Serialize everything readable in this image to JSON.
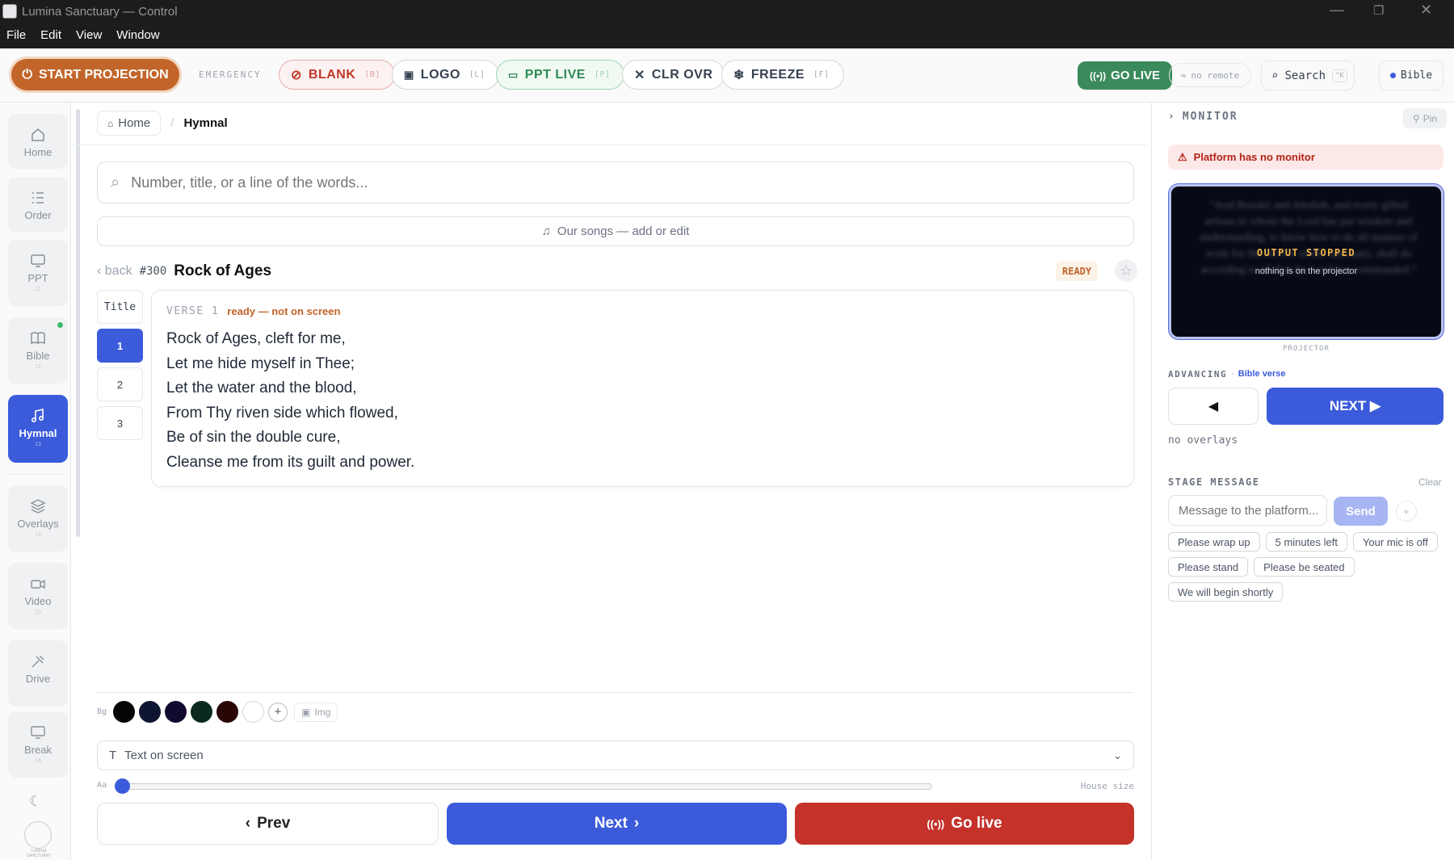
{
  "window": {
    "title": "Lumina Sanctuary — Control",
    "minimize": "—",
    "maximize": "❐",
    "close": "✕"
  },
  "menu": [
    "File",
    "Edit",
    "View",
    "Window"
  ],
  "toolbar": {
    "start_projection": "START PROJECTION",
    "emergency": "EMERGENCY",
    "blank": {
      "label": "BLANK",
      "key": "[B]"
    },
    "logo": {
      "label": "LOGO",
      "key": "[L]"
    },
    "ppt_live": {
      "label": "PPT LIVE",
      "key": "[P]"
    },
    "clr_ovr": {
      "label": "CLR OVR"
    },
    "freeze": {
      "label": "FREEZE",
      "key": "[F]"
    },
    "go_live": "GO LIVE",
    "no_remote": "no remote",
    "search": {
      "label": "Search",
      "key": "^K"
    },
    "bible": "Bible"
  },
  "sidebar": [
    {
      "label": "Home",
      "num": "",
      "icon": "home-icon"
    },
    {
      "label": "Order",
      "num": "",
      "icon": "list-icon"
    },
    {
      "label": "PPT",
      "num": "11",
      "icon": "monitor-icon"
    },
    {
      "label": "Bible",
      "num": "12",
      "icon": "book-icon"
    },
    {
      "label": "Hymnal",
      "num": "13",
      "icon": "music-icon"
    },
    {
      "label": "Overlays",
      "num": "14",
      "icon": "layers-icon"
    },
    {
      "label": "Video",
      "num": "15",
      "icon": "video-icon"
    },
    {
      "label": "Drive",
      "num": "",
      "icon": "drive-icon"
    },
    {
      "label": "Break",
      "num": "16",
      "icon": "screen-icon"
    }
  ],
  "logo_text": "LUMINA SANCTUARY",
  "breadcrumb": {
    "home": "Home",
    "sep": "/",
    "current": "Hymnal"
  },
  "search": {
    "placeholder": "Number, title, or a line of the words..."
  },
  "our_songs": "Our songs — add or edit",
  "song": {
    "back": "back",
    "number": "#300",
    "title": "Rock of Ages",
    "status": "READY"
  },
  "verse_nav": [
    "Title",
    "1",
    "2",
    "3"
  ],
  "verse": {
    "label": "VERSE 1",
    "status": "ready — not on screen",
    "lines": [
      "Rock of Ages, cleft for me,",
      "Let me hide myself in Thee;",
      "Let the water and the blood,",
      "From Thy riven side which flowed,",
      "Be of sin the double cure,",
      "Cleanse me from its guilt and power."
    ]
  },
  "bg": {
    "label": "Bg",
    "colors": [
      "#050505",
      "#0d1530",
      "#120a2e",
      "#0a2a1e",
      "#2a0505",
      "#ffffff"
    ],
    "add": "+",
    "img": "Img"
  },
  "text_on_screen": "Text on screen",
  "size": {
    "label": "Aa",
    "value_label": "House size",
    "value": 0.0
  },
  "bottom": {
    "prev": "Prev",
    "next": "Next",
    "golive": "Go live"
  },
  "monitor": {
    "heading": "MONITOR",
    "pin": "Pin",
    "warning": "Platform has no monitor",
    "preview_text": "“And Bezalel and Aholiab, and every gifted artisan in whom the Lord has put wisdom and understanding, to know how to do all manner of work for the service of the sanctuary, shall do according to all that the Lord has commanded.”",
    "output_stopped": "OUTPUT STOPPED",
    "output_sub": "nothing is on the projector",
    "projector_label": "PROJECTOR"
  },
  "advancing": {
    "label": "ADVANCING",
    "dot": "·",
    "mode": "Bible verse",
    "prev": "◀",
    "next": "NEXT ▶",
    "overlays": "no overlays"
  },
  "stage_message": {
    "heading": "STAGE MESSAGE",
    "clear": "Clear",
    "placeholder": "Message to the platform...",
    "send": "Send",
    "plus": "+",
    "presets": [
      "Please wrap up",
      "5 minutes left",
      "Your mic is off",
      "Please stand",
      "Please be seated",
      "We will begin shortly"
    ]
  },
  "colors": {
    "accent": "#3b5bdb",
    "brand": "#c2652a",
    "live_green": "#3a8a5c",
    "golive_red": "#c4322a"
  }
}
